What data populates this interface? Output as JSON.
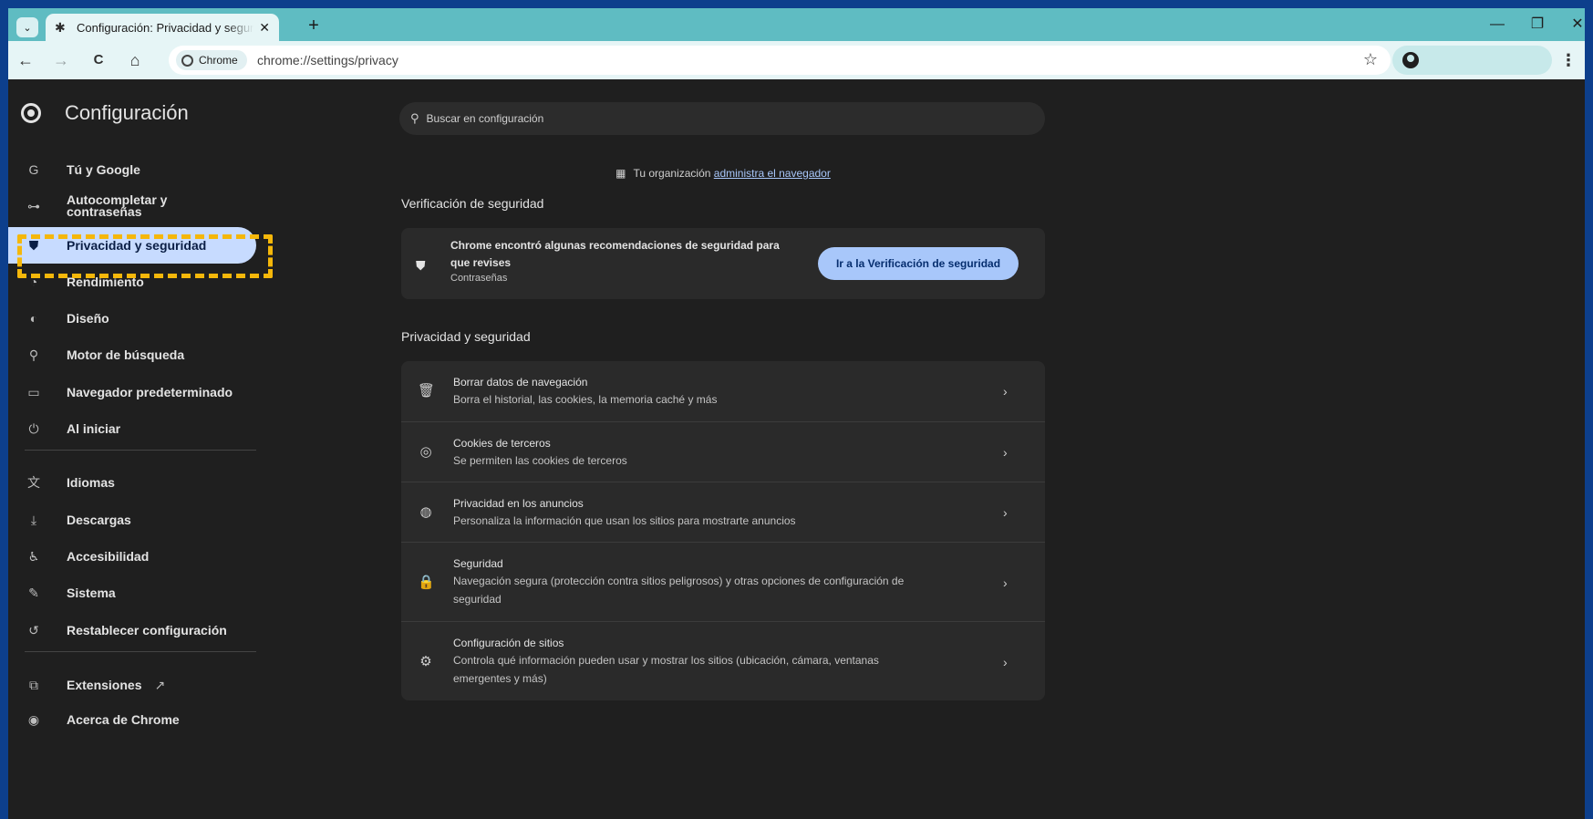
{
  "tab": {
    "title": "Configuración: Privacidad y seguridad",
    "close": "✕",
    "new": "+"
  },
  "window_controls": {
    "minimize": "—",
    "restore": "❐",
    "close": "✕"
  },
  "toolbar": {
    "back": "←",
    "forward": "→",
    "reload": "C",
    "home": "⌂",
    "chip_label": "Chrome",
    "url": "chrome://settings/privacy",
    "star": "☆",
    "menu": "⋮"
  },
  "header": {
    "title": "Configuración",
    "search_placeholder": "Buscar en configuración"
  },
  "sidebar": {
    "items": [
      {
        "icon": "G",
        "label": "Tú y Google"
      },
      {
        "icon": "⊶",
        "label": "Autocompletar y contraseñas"
      },
      {
        "icon": "⛊",
        "label": "Privacidad y seguridad"
      },
      {
        "icon": "◔",
        "label": "Rendimiento"
      },
      {
        "icon": "◐",
        "label": "Diseño"
      },
      {
        "icon": "⚲",
        "label": "Motor de búsqueda"
      },
      {
        "icon": "▭",
        "label": "Navegador predeterminado"
      },
      {
        "icon": "⏻",
        "label": "Al iniciar"
      },
      {
        "icon": "文",
        "label": "Idiomas"
      },
      {
        "icon": "⤓",
        "label": "Descargas"
      },
      {
        "icon": "♿",
        "label": "Accesibilidad"
      },
      {
        "icon": "✎",
        "label": "Sistema"
      },
      {
        "icon": "↺",
        "label": "Restablecer configuración"
      },
      {
        "icon": "⧉",
        "label": "Extensiones",
        "extra_icon": "↗"
      },
      {
        "icon": "◉",
        "label": "Acerca de Chrome"
      }
    ]
  },
  "org_notice": {
    "prefix": "Tu organización",
    "link": "administra el navegador"
  },
  "safety_check": {
    "section_title": "Verificación de seguridad",
    "line1": "Chrome encontró algunas recomendaciones de seguridad para",
    "line2": "que revises",
    "subtitle": "Contraseñas",
    "button": "Ir a la Verificación de seguridad"
  },
  "privacy": {
    "section_title": "Privacidad y seguridad",
    "rows": [
      {
        "icon": "🗑",
        "title": "Borrar datos de navegación",
        "sub": [
          "Borra el historial, las cookies, la memoria caché y más"
        ]
      },
      {
        "icon": "◎",
        "title": "Cookies de terceros",
        "sub": [
          "Se permiten las cookies de terceros"
        ]
      },
      {
        "icon": "◍",
        "title": "Privacidad en los anuncios",
        "sub": [
          "Personaliza la información que usan los sitios para mostrarte anuncios"
        ]
      },
      {
        "icon": "🔒",
        "title": "Seguridad",
        "sub": [
          "Navegación segura (protección contra sitios peligrosos) y otras opciones de configuración de",
          "seguridad"
        ]
      },
      {
        "icon": "⚙",
        "title": "Configuración de sitios",
        "sub": [
          "Controla qué información pueden usar y mostrar los sitios (ubicación, cámara, ventanas",
          "emergentes y más)"
        ]
      }
    ],
    "chevron": "›"
  }
}
